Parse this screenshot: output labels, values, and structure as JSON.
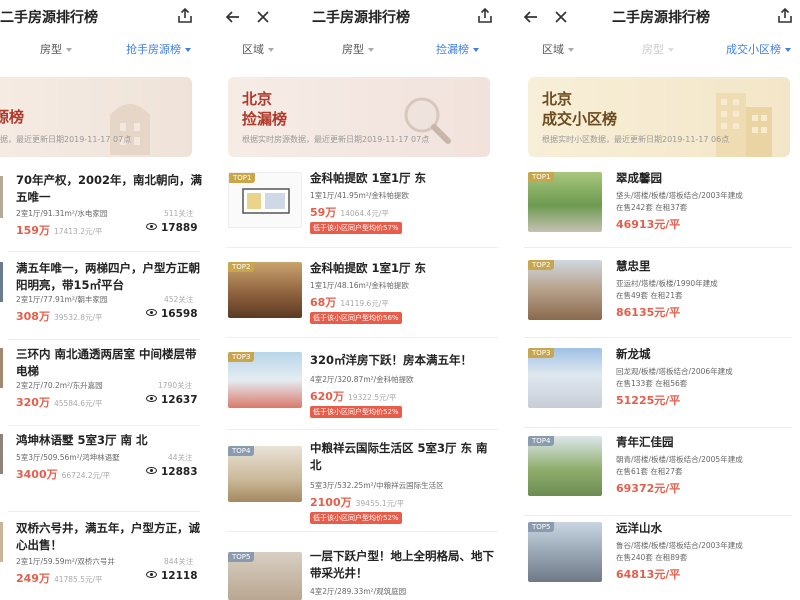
{
  "panel1": {
    "title": "二手房源排行榜",
    "filters": [
      "房型",
      "抢手房源榜"
    ],
    "banner": {
      "t1": "源榜",
      "sub": "据，最近更新日期2019-11-17 07点"
    },
    "items": [
      {
        "title": "70年产权，2002年，南北朝向，满五唯一",
        "meta": "2室1厅/91.31m²/水电家园",
        "attn": "511关注",
        "price": "159万",
        "unit": "17413.2元/平",
        "views": "17889"
      },
      {
        "title": "满五年唯一，两梯四户，户型方正朝阳明亮，带15㎡平台",
        "meta": "2室1厅/77.91m²/朝丰家园",
        "attn": "452关注",
        "price": "308万",
        "unit": "39532.8元/平",
        "views": "16598"
      },
      {
        "title": "三环内 南北通透两居室 中间楼层带电梯",
        "meta": "2室2厅/70.2m²/东升嘉园",
        "attn": "1790关注",
        "price": "320万",
        "unit": "45584.6元/平",
        "views": "12637"
      },
      {
        "title": "鸿坤林语墅 5室3厅 南 北",
        "meta": "5室3厅/509.56m²/鸿坤林语墅",
        "attn": "44关注",
        "price": "3400万",
        "unit": "66724.2元/平",
        "views": "12883"
      },
      {
        "title": "双桥六号井，满五年，户型方正，诚心出售！",
        "meta": "2室1厅/59.59m²/双桥六号井",
        "attn": "844关注",
        "price": "249万",
        "unit": "41785.5元/平",
        "views": "12118"
      }
    ]
  },
  "panel2": {
    "title": "二手房源排行榜",
    "filters": [
      "区域",
      "房型",
      "捡漏榜"
    ],
    "banner": {
      "t1": "北京",
      "t2": "捡漏榜",
      "sub": "根据实时房源数据，最近更新日期2019-11-17 07点"
    },
    "items": [
      {
        "tag": "TOP1",
        "title": "金科帕提欧 1室1厅 东",
        "meta": "1室1厅/41.95m²/金科帕提欧",
        "price": "59万",
        "unit": "14064.4元/平",
        "chip": "低于该小区同户型均价57%"
      },
      {
        "tag": "TOP2",
        "title": "金科帕提欧 1室1厅 东",
        "meta": "1室1厅/48.16m²/金科帕提欧",
        "price": "68万",
        "unit": "14119.6元/平",
        "chip": "低于该小区同户型均价56%"
      },
      {
        "tag": "TOP3",
        "title": "320㎡洋房下跃！房本满五年！",
        "meta": "4室2厅/320.87m²/金科帕提欧",
        "price": "620万",
        "unit": "19322.5元/平",
        "chip": "低于该小区同户型均价52%"
      },
      {
        "tag": "TOP4",
        "title": "中粮祥云国际生活区 5室3厅 东 南 北",
        "meta": "5室3厅/532.25m²/中粮祥云国际生活区",
        "price": "2100万",
        "unit": "39455.1元/平",
        "chip": "低于该小区同户型均价52%"
      },
      {
        "tag": "TOP5",
        "title": "一层下跃户型！地上全明格局、地下带采光井！",
        "meta": "4室2厅/289.33m²/观筑庭园",
        "price": "",
        "unit": "",
        "chip": ""
      }
    ]
  },
  "panel3": {
    "title": "二手房源排行榜",
    "filters": [
      "区域",
      "房型",
      "成交小区榜"
    ],
    "banner": {
      "t1": "北京",
      "t2": "成交小区榜",
      "sub": "根据实时小区数据，最近更新日期2019-11-17 06点"
    },
    "items": [
      {
        "tag": "TOP1",
        "title": "翠成馨园",
        "meta": "垡头/塔楼/板楼/塔板结合/2003年建成",
        "stat": "在售242套  在租37套",
        "price": "46913元/平"
      },
      {
        "tag": "TOP2",
        "title": "慧忠里",
        "meta": "亚运村/塔楼/板楼/1990年建成",
        "stat": "在售49套  在租21套",
        "price": "86135元/平"
      },
      {
        "tag": "TOP3",
        "title": "新龙城",
        "meta": "回龙观/板楼/塔板结合/2006年建成",
        "stat": "在售133套  在租56套",
        "price": "51225元/平"
      },
      {
        "tag": "TOP4",
        "title": "青年汇佳园",
        "meta": "朝青/塔楼/板楼/塔板结合/2005年建成",
        "stat": "在售61套  在租27套",
        "price": "69372元/平"
      },
      {
        "tag": "TOP5",
        "title": "远洋山水",
        "meta": "鲁谷/塔楼/板楼/塔板结合/2003年建成",
        "stat": "在售240套  在租89套",
        "price": "64813元/平"
      }
    ]
  },
  "colors": {
    "accent": "#3f7ee8",
    "price": "#e85d4a",
    "brand_red": "#b0392b",
    "gold": "#c9a64a"
  },
  "icons": [
    "back-arrow-icon",
    "close-icon",
    "share-icon",
    "eye-icon"
  ]
}
